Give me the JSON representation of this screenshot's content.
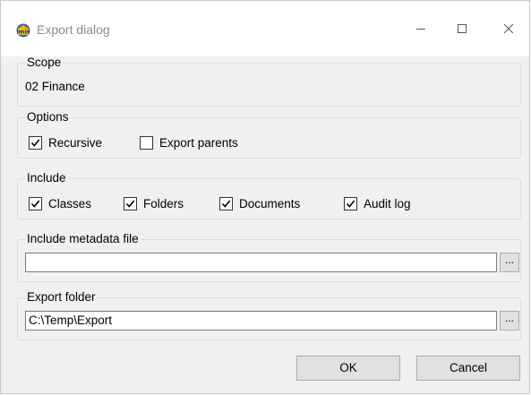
{
  "window": {
    "title": "Export dialog",
    "app_icon": "imis-app-icon",
    "controls": {
      "minimize": "minimize-icon",
      "maximize": "maximize-icon",
      "close": "close-icon"
    }
  },
  "scope": {
    "legend": "Scope",
    "value": "02 Finance"
  },
  "options": {
    "legend": "Options",
    "items": [
      {
        "label": "Recursive",
        "checked": true
      },
      {
        "label": "Export parents",
        "checked": false
      }
    ]
  },
  "include": {
    "legend": "Include",
    "items": [
      {
        "label": "Classes",
        "checked": true
      },
      {
        "label": "Folders",
        "checked": true
      },
      {
        "label": "Documents",
        "checked": true
      },
      {
        "label": "Audit log",
        "checked": true
      }
    ]
  },
  "metadata": {
    "legend": "Include metadata file",
    "value": "",
    "browse_label": "..."
  },
  "export_folder": {
    "legend": "Export folder",
    "value": "C:\\Temp\\Export",
    "browse_label": "..."
  },
  "buttons": {
    "ok": "OK",
    "cancel": "Cancel"
  }
}
